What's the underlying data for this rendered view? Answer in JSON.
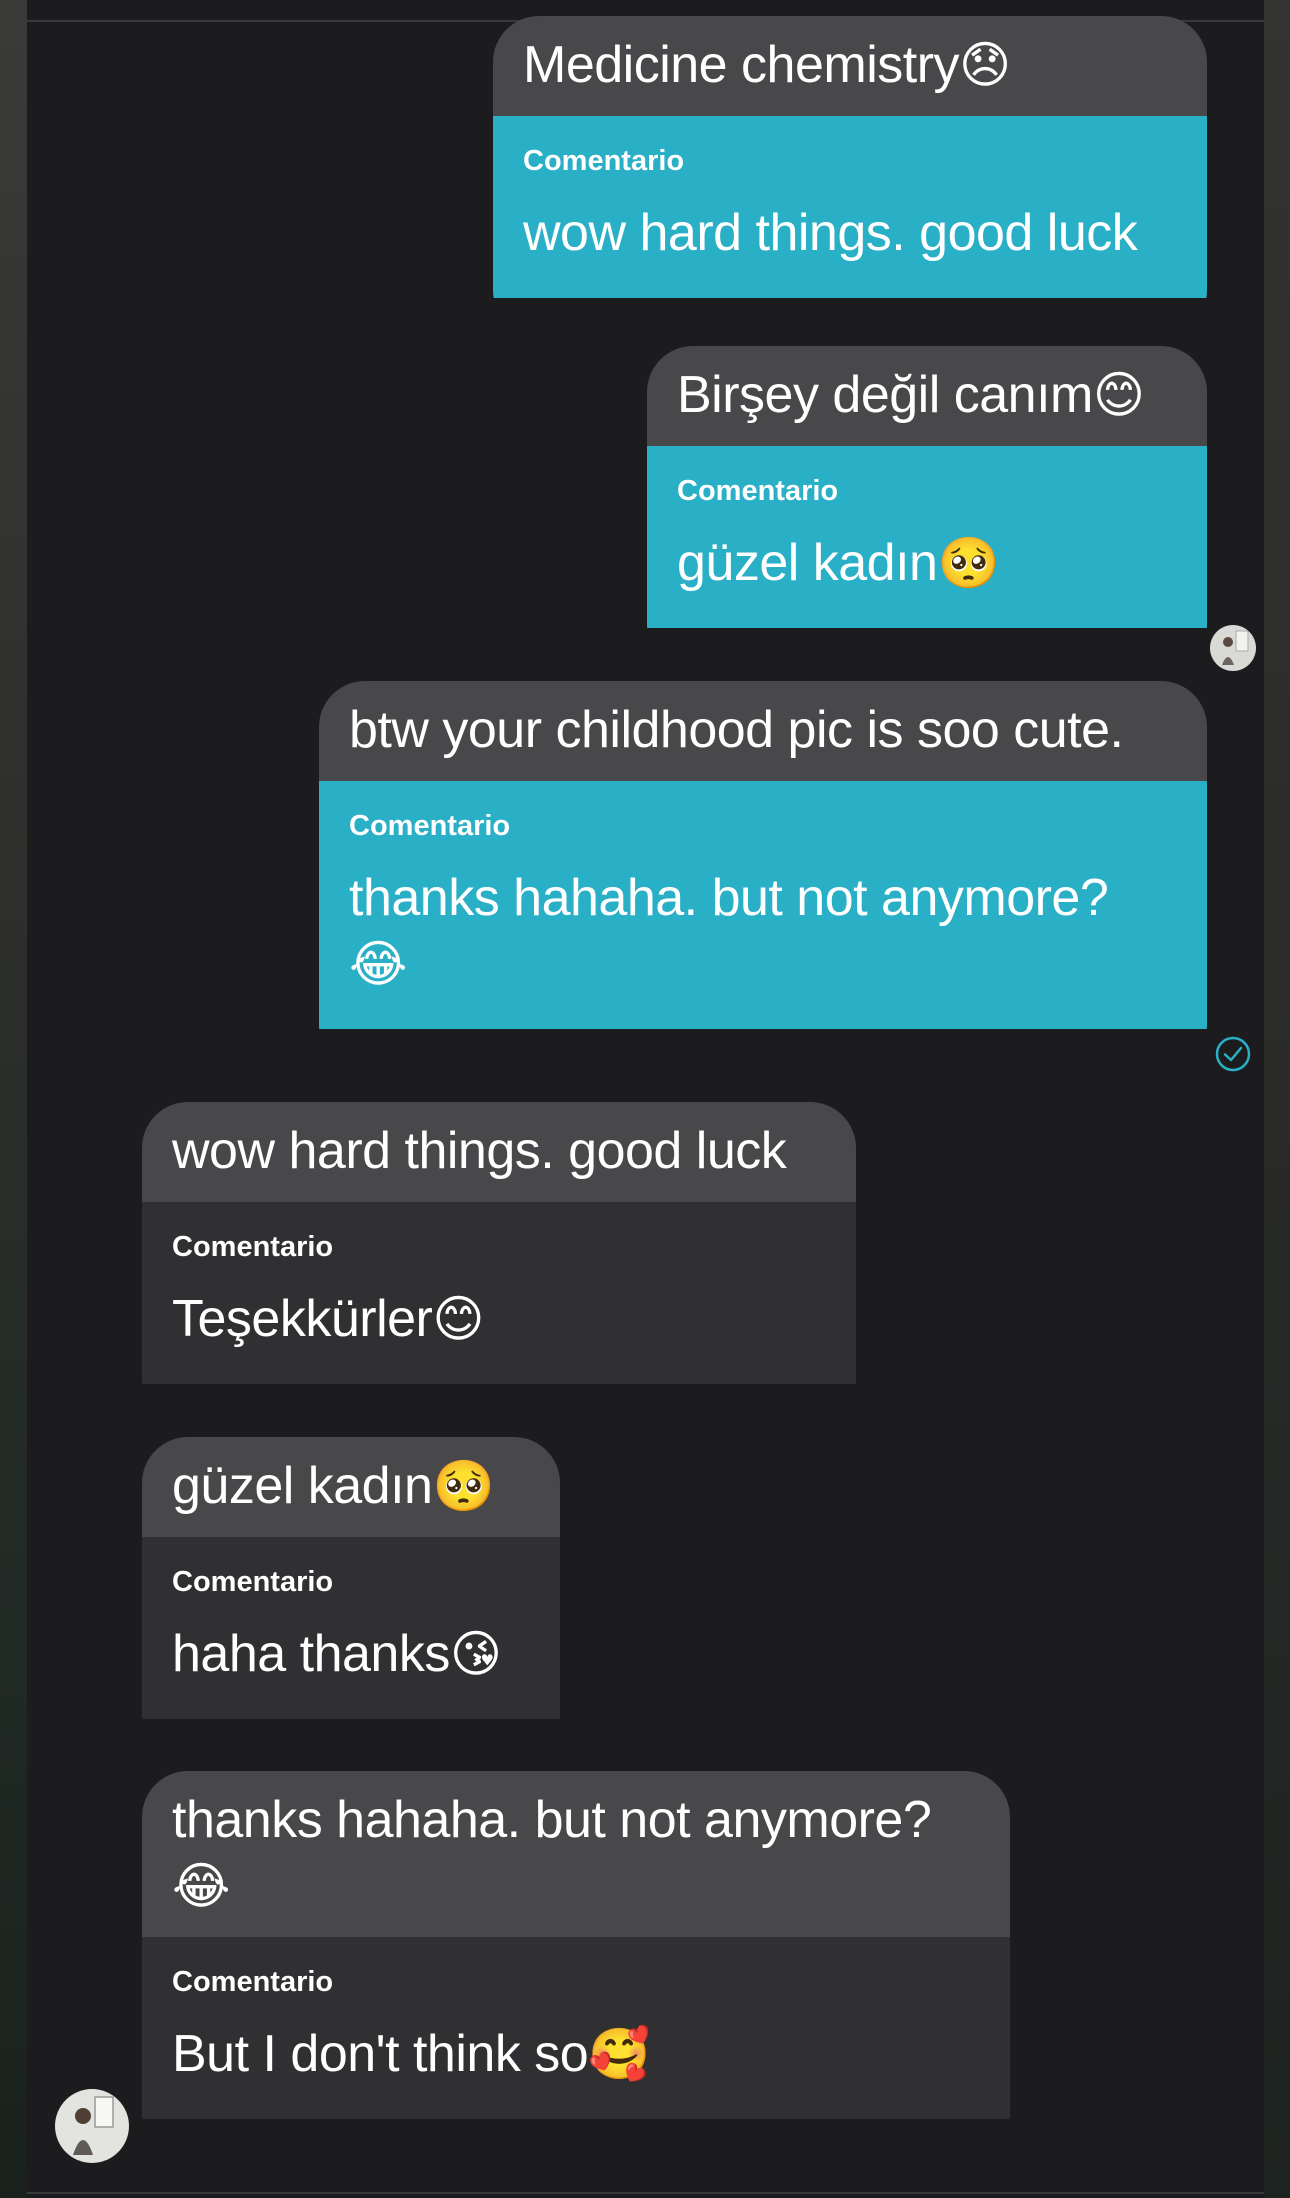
{
  "chat": {
    "messages": [
      {
        "direction": "outgoing",
        "quote": "Medicine chemistry",
        "quote_emoji": "😞",
        "label": "Comentario",
        "text": "wow hard things. good luck",
        "text_emoji": ""
      },
      {
        "direction": "outgoing",
        "quote": "Birşey değil canım",
        "quote_emoji": "😊",
        "label": "Comentario",
        "text": "güzel kadın",
        "text_emoji": "🥺"
      },
      {
        "direction": "outgoing",
        "quote": "btw your childhood pic is soo cute.",
        "quote_emoji": "",
        "label": "Comentario",
        "text": "thanks hahaha. but not anymore?",
        "text_emoji": "😂"
      },
      {
        "direction": "incoming",
        "quote": "wow hard things. good luck",
        "quote_emoji": "",
        "label": "Comentario",
        "text": "Teşekkürler",
        "text_emoji": "😊"
      },
      {
        "direction": "incoming",
        "quote": "güzel kadın",
        "quote_emoji": "🥺",
        "label": "Comentario",
        "text": "haha thanks",
        "text_emoji": "😘"
      },
      {
        "direction": "incoming",
        "quote": "thanks hahaha. but not anymore?",
        "quote_emoji": "😂",
        "label": "Comentario",
        "text": "But I don't think so",
        "text_emoji": "🥰"
      }
    ]
  },
  "icons": {
    "read_receipt": "check-circle-icon",
    "contact_avatar": "avatar",
    "own_avatar": "avatar"
  },
  "colors": {
    "background": "#1c1c1e",
    "outgoing_bubble": "#29afc6",
    "incoming_bubble": "#303033",
    "quote_block": "#48484a",
    "read_receipt": "#29afc6"
  }
}
